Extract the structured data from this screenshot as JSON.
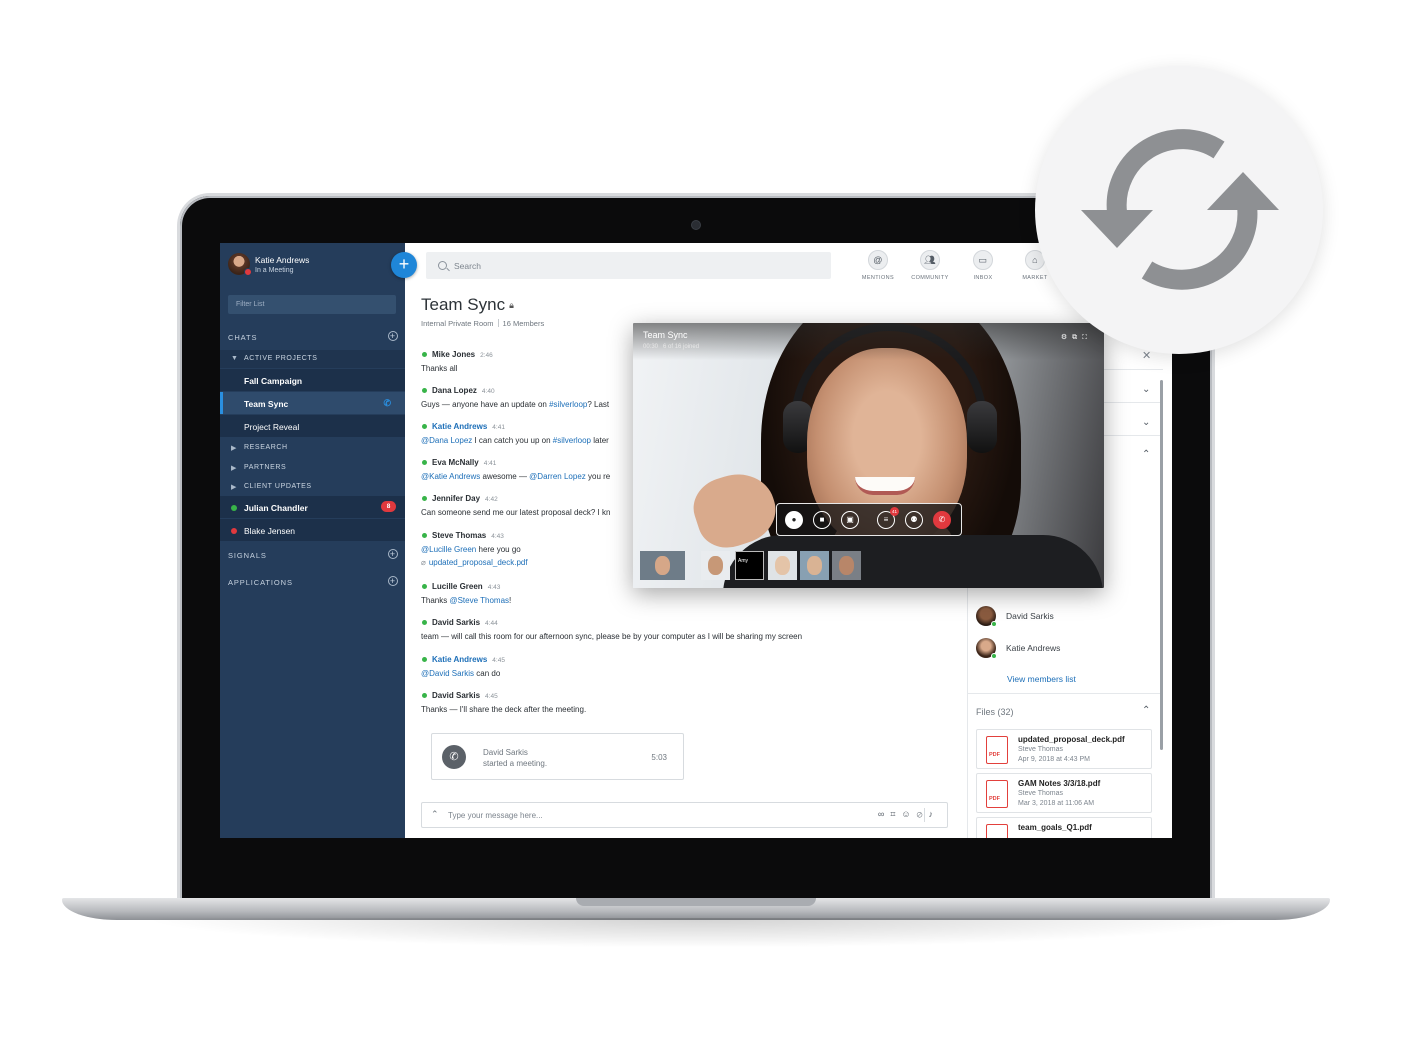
{
  "profile": {
    "name": "Katie Andrews",
    "status": "In a Meeting"
  },
  "sidebar": {
    "new_button": "+",
    "filter_placeholder": "Filter List",
    "chats_header": "CHATS",
    "active_projects": "ACTIVE PROJECTS",
    "projects": [
      "Fall Campaign",
      "Team Sync",
      "Project Reveal"
    ],
    "groups": [
      "RESEARCH",
      "PARTNERS",
      "CLIENT UPDATES"
    ],
    "direct": [
      {
        "name": "Julian Chandler",
        "badge": "8"
      },
      {
        "name": "Blake Jensen"
      }
    ],
    "signals_header": "SIGNALS",
    "applications_header": "APPLICATIONS"
  },
  "search": {
    "placeholder": "Search"
  },
  "nav": [
    {
      "label": "MENTIONS",
      "icon": "at-icon"
    },
    {
      "label": "COMMUNITY",
      "icon": "community-icon"
    },
    {
      "label": "INBOX",
      "icon": "inbox-icon"
    },
    {
      "label": "MARKET",
      "icon": "market-icon"
    }
  ],
  "room": {
    "title": "Team Sync",
    "type": "Internal Private Room",
    "members": "16 Members"
  },
  "messages": [
    {
      "author": "Mike Jones",
      "time": "2:46",
      "parts": [
        "Thanks all"
      ]
    },
    {
      "author": "Dana Lopez",
      "time": "4:40",
      "pre": "Guys — anyone have an update on ",
      "mention": "#silverloop",
      "post": "? Last"
    },
    {
      "author": "Katie Andrews",
      "time": "4:41",
      "me": true,
      "mention": "@Dana Lopez",
      "mid": " I can catch you up on ",
      "mention2": "#silverloop",
      "post": " later"
    },
    {
      "author": "Eva McNally",
      "time": "4:41",
      "mention": "@Katie Andrews",
      "mid": " awesome — ",
      "mention2": "@Darren Lopez",
      "post": " you re"
    },
    {
      "author": "Jennifer Day",
      "time": "4:42",
      "parts": [
        "Can someone send me our latest proposal deck? I kn"
      ]
    },
    {
      "author": "Steve Thomas",
      "time": "4:43",
      "mention": "@Lucille Green",
      "post": " here you go",
      "attachment": "updated_proposal_deck.pdf"
    },
    {
      "author": "Lucille Green",
      "time": "4:43",
      "pre": "Thanks ",
      "mention": "@Steve Thomas",
      "post": "!"
    },
    {
      "author": "David Sarkis",
      "time": "4:44",
      "parts": [
        "team — will call this room for our afternoon sync, please be by your computer as I will be sharing my screen"
      ]
    },
    {
      "author": "Katie Andrews",
      "time": "4:45",
      "me": true,
      "mention": "@David Sarkis",
      "post": " can do"
    },
    {
      "author": "David Sarkis",
      "time": "4:45",
      "parts": [
        "Thanks — I'll share the deck after the meeting."
      ]
    }
  ],
  "meeting_card": {
    "who": "David Sarkis",
    "what": "started a meeting.",
    "duration": "5:03"
  },
  "composer": {
    "placeholder": "Type your message here..."
  },
  "right_panel": {
    "members": [
      "David Sarkis",
      "Katie Andrews"
    ],
    "view_members": "View members list",
    "files_header": "Files (32)",
    "files": [
      {
        "name": "updated_proposal_deck.pdf",
        "by": "Steve Thomas",
        "date": "Apr 9, 2018 at 4:43 PM",
        "type": "PDF"
      },
      {
        "name": "GAM Notes 3/3/18.pdf",
        "by": "Steve Thomas",
        "date": "Mar 3, 2018 at 11:06 AM",
        "type": "PDF"
      },
      {
        "name": "team_goals_Q1.pdf",
        "type": "PDF"
      }
    ]
  },
  "video_call": {
    "title": "Team Sync",
    "elapsed": "00:30",
    "joined": "6 of 16 joined",
    "chat_badge": "41",
    "thumb_label": "Amy"
  },
  "colors": {
    "sidebar": "#253d5b",
    "accent": "#1f86d8",
    "online": "#38b449",
    "alert": "#e0393e",
    "link": "#1d6fb8"
  }
}
